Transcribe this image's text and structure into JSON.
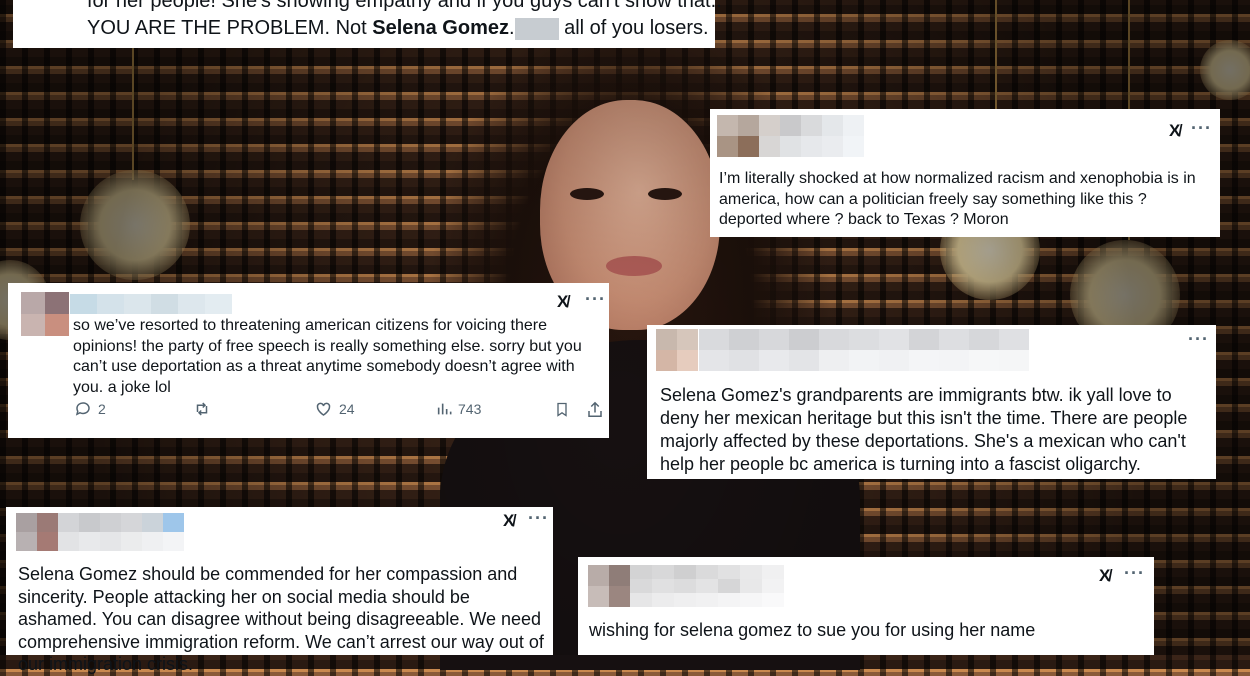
{
  "top_card": {
    "line1": "for her people! She's showing empathy and if you guys can't show that..",
    "line2_start": "YOU ARE THE PROBLEM. Not ",
    "line2_bold": "Selena Gomez",
    "line2_period": ".",
    "line2_end": " all of you losers."
  },
  "tweet_racism": {
    "text": "I’m literally shocked at how normalized racism and xenophobia is in america, how can a politician freely say something like this ? deported where ? back to Texas ? Moron",
    "x_logo": "X̸",
    "more": "···"
  },
  "tweet_threatening": {
    "text": "so we’ve resorted to threatening american citizens for voicing there opinions! the party of free speech is really something else. sorry but you can’t use deportation as a threat anytime somebody doesn’t agree with you. a joke lol",
    "x_logo": "X̸",
    "more": "···",
    "replies": "2",
    "likes": "24",
    "views": "743"
  },
  "tweet_grandparents": {
    "text": "Selena Gomez's grandparents are immigrants btw. ik yall love to deny her mexican heritage but this isn't the time. There are people majorly affected by these deportations. She's a mexican who can't help her people bc america is turning into a fascist oligarchy.",
    "more": "···"
  },
  "tweet_commended": {
    "text": "Selena Gomez should be commended for her compassion and sincerity. People attacking her on social media should be ashamed. You can disagree without being disagreeable. We need comprehensive immigration reform. We can’t arrest our way out of our immigration crisis.",
    "x_logo": "X̸",
    "more": "···"
  },
  "tweet_sue": {
    "text": "wishing for selena gomez to sue you for using her name",
    "x_logo": "X̸",
    "more": "···"
  }
}
